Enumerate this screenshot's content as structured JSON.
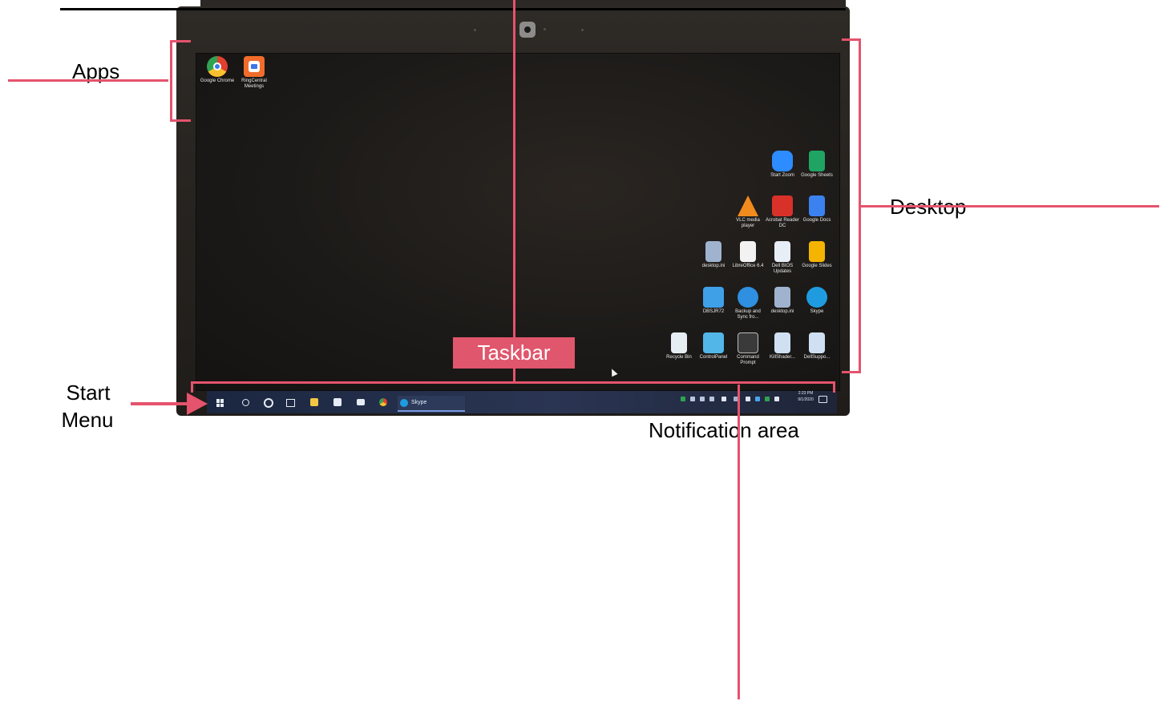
{
  "annotations": {
    "apps": "Apps",
    "desktop": "Desktop",
    "start_menu_line1": "Start",
    "start_menu_line2": "Menu",
    "taskbar": "Taskbar",
    "notification_area": "Notification area"
  },
  "desktop_top_left_icons": [
    {
      "label": "Google Chrome",
      "icon": "chrome-icon",
      "color": "#e0402f"
    },
    {
      "label": "RingCentral Meetings",
      "icon": "ringcentral-icon",
      "color": "#f26c2b"
    }
  ],
  "desktop_right_icons": [
    {
      "label": "Start Zoom",
      "icon": "zoom-icon",
      "color": "#2d8cff"
    },
    {
      "label": "Google Sheets",
      "icon": "sheets-icon",
      "color": "#1fa463"
    },
    {
      "label": "VLC media player",
      "icon": "vlc-icon",
      "color": "#f28b1e"
    },
    {
      "label": "Acrobat Reader DC",
      "icon": "acrobat-icon",
      "color": "#d8312a"
    },
    {
      "label": "Google Docs",
      "icon": "docs-icon",
      "color": "#3b82f0"
    },
    {
      "label": "desktop.ini",
      "icon": "settings-file-icon",
      "color": "#9fb3cf"
    },
    {
      "label": "LibreOffice 6.4",
      "icon": "libreoffice-icon",
      "color": "#f2f2f2"
    },
    {
      "label": "Dell BIOS Updates",
      "icon": "dell-bios-icon",
      "color": "#e8eef6"
    },
    {
      "label": "Google Slides",
      "icon": "slides-icon",
      "color": "#f4b400"
    },
    {
      "label": "DBSJR72",
      "icon": "network-drive-icon",
      "color": "#3fa0e8"
    },
    {
      "label": "Backup and Sync fro...",
      "icon": "backup-sync-icon",
      "color": "#2f8fe0"
    },
    {
      "label": "desktop.ini",
      "icon": "settings-file-icon",
      "color": "#9fb3cf"
    },
    {
      "label": "Skype",
      "icon": "skype-icon",
      "color": "#1f9ce0"
    },
    {
      "label": "Recycle Bin",
      "icon": "recycle-bin-icon",
      "color": "#e6eef4"
    },
    {
      "label": "ControlPanel",
      "icon": "control-panel-icon",
      "color": "#52b6e8"
    },
    {
      "label": "Command Prompt",
      "icon": "command-prompt-icon",
      "color": "#3a3a3a"
    },
    {
      "label": "KillShader...",
      "icon": "file-icon",
      "color": "#cfe0f2"
    },
    {
      "label": "DellSuppo...",
      "icon": "file-icon",
      "color": "#cfe0f2"
    }
  ],
  "taskbar": {
    "skype_label": "Skype",
    "time": "2:23 PM",
    "date": "9/1/2020"
  }
}
